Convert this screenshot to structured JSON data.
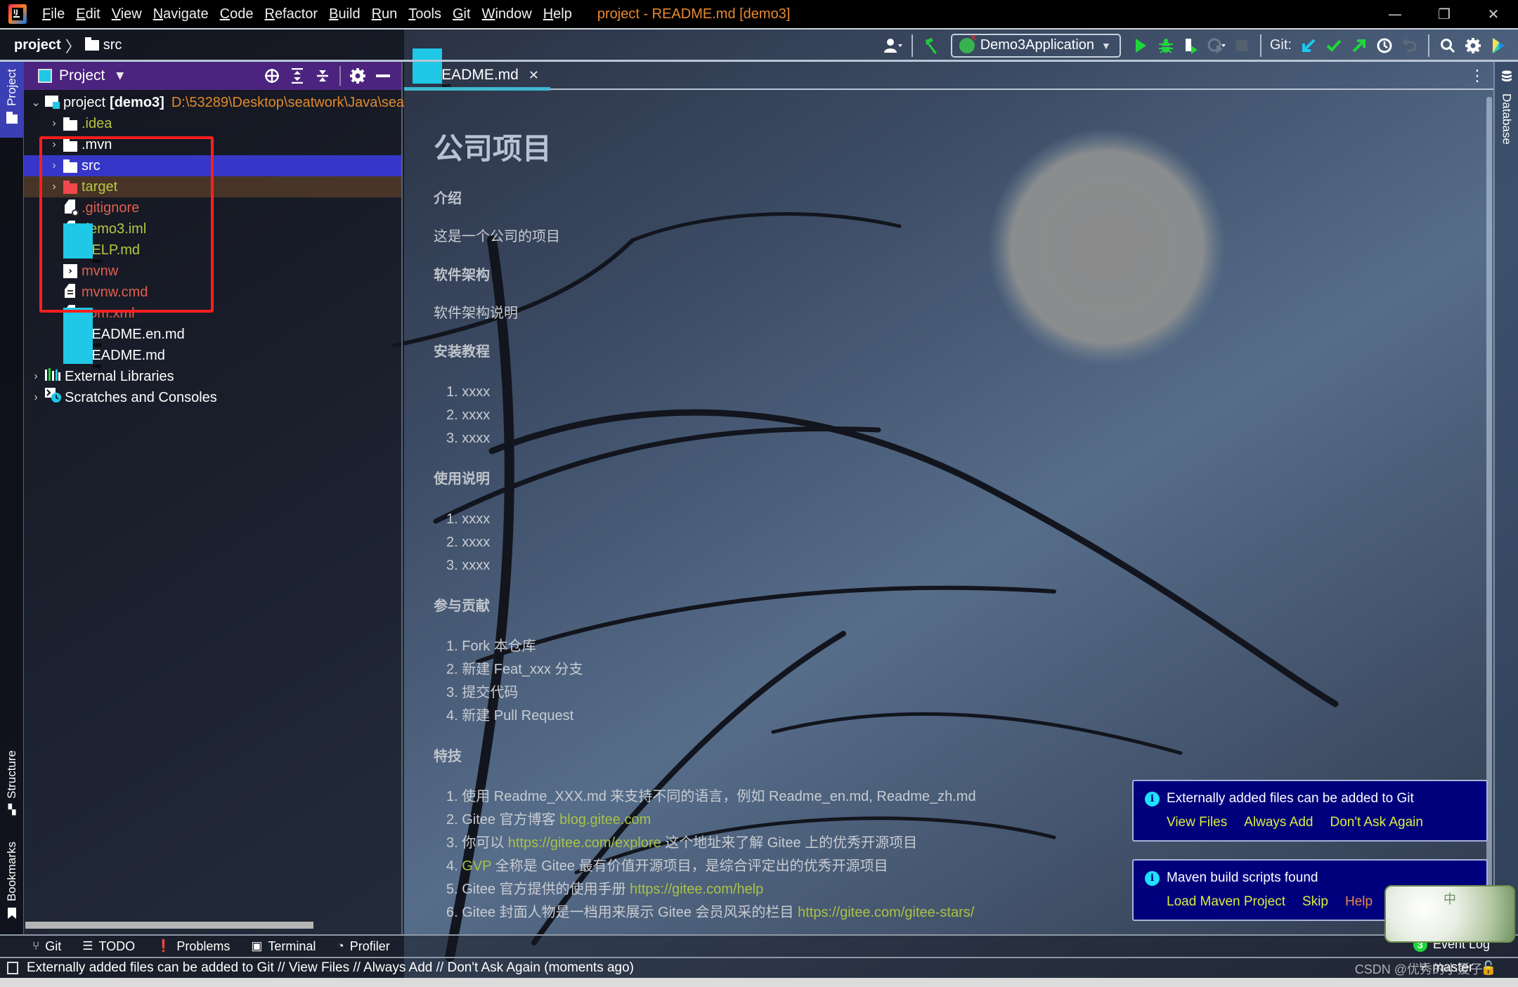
{
  "titlebar": {
    "menu": [
      "File",
      "Edit",
      "View",
      "Navigate",
      "Code",
      "Refactor",
      "Build",
      "Run",
      "Tools",
      "Git",
      "Window",
      "Help"
    ],
    "window_title": "project - README.md [demo3]",
    "controls": {
      "minimize": "—",
      "restore": "❐",
      "close": "✕"
    }
  },
  "navbar": {
    "breadcrumb": {
      "root": "project",
      "separator": "〉",
      "leaf": "src"
    },
    "run_config": "Demo3Application",
    "git_label": "Git:"
  },
  "left_stripe": {
    "project": "Project",
    "structure": "Structure",
    "bookmarks": "Bookmarks"
  },
  "right_stripe": {
    "database": "Database"
  },
  "project_panel": {
    "title": "Project",
    "root": {
      "name": "project",
      "module": "[demo3]",
      "path": "D:\\53289\\Desktop\\seatwork\\Java\\sea"
    },
    "items": [
      {
        "name": ".idea",
        "type": "folder",
        "color": "olive",
        "expandable": true
      },
      {
        "name": ".mvn",
        "type": "folder",
        "color": "white",
        "expandable": true
      },
      {
        "name": "src",
        "type": "folder",
        "color": "white",
        "expandable": true,
        "selected": true
      },
      {
        "name": "target",
        "type": "folder-excluded",
        "color": "olive",
        "expandable": true
      },
      {
        "name": ".gitignore",
        "type": "file",
        "color": "red"
      },
      {
        "name": "demo3.iml",
        "type": "file",
        "color": "olive"
      },
      {
        "name": "HELP.md",
        "type": "md",
        "color": "olive"
      },
      {
        "name": "mvnw",
        "type": "shell",
        "color": "red"
      },
      {
        "name": "mvnw.cmd",
        "type": "text",
        "color": "red"
      },
      {
        "name": "pom.xml",
        "type": "xml",
        "color": "red"
      },
      {
        "name": "README.en.md",
        "type": "md",
        "color": "white"
      },
      {
        "name": "README.md",
        "type": "md",
        "color": "white"
      }
    ],
    "extra": [
      {
        "name": "External Libraries"
      },
      {
        "name": "Scratches and Consoles"
      }
    ]
  },
  "editor": {
    "tab": {
      "label": "README.md",
      "badge": "MD"
    },
    "markdown": {
      "title": "公司项目",
      "sections": [
        {
          "heading": "介绍",
          "text": "这是一个公司的项目"
        },
        {
          "heading": "软件架构",
          "text": "软件架构说明"
        },
        {
          "heading": "安装教程",
          "list": [
            "1. xxxx",
            "2. xxxx",
            "3. xxxx"
          ]
        },
        {
          "heading": "使用说明",
          "list": [
            "1. xxxx",
            "2. xxxx",
            "3. xxxx"
          ]
        },
        {
          "heading": "参与贡献",
          "list": [
            "1. Fork 本仓库",
            "2. 新建 Feat_xxx 分支",
            "3. 提交代码",
            "4. 新建 Pull Request"
          ]
        },
        {
          "heading": "特技"
        }
      ],
      "features": [
        {
          "pre": "1. 使用 Readme_XXX.md 来支持不同的语言，例如 Readme_en.md, Readme_zh.md",
          "link": "",
          "post": ""
        },
        {
          "pre": "2. Gitee 官方博客 ",
          "link": "blog.gitee.com",
          "post": ""
        },
        {
          "pre": "3. 你可以 ",
          "link": "https://gitee.com/explore",
          "post": " 这个地址来了解 Gitee 上的优秀开源项目"
        },
        {
          "pre": "4. ",
          "link": "GVP",
          "post": " 全称是 Gitee 最有价值开源项目，是综合评定出的优秀开源项目"
        },
        {
          "pre": "5. Gitee 官方提供的使用手册 ",
          "link": "https://gitee.com/help",
          "post": ""
        },
        {
          "pre": "6. Gitee 封面人物是一档用来展示 Gitee 会员风采的栏目 ",
          "link": "https://gitee.com/gitee-stars/",
          "post": ""
        }
      ]
    }
  },
  "notifications": [
    {
      "title": "Externally added files can be added to Git",
      "actions": [
        "View Files",
        "Always Add",
        "Don't Ask Again"
      ]
    },
    {
      "title": "Maven build scripts found",
      "actions": [
        "Load Maven Project",
        "Skip",
        "Help"
      ]
    }
  ],
  "sticker": {
    "char": "中"
  },
  "bottom_toolbar": {
    "buttons": [
      "Git",
      "TODO",
      "Problems",
      "Terminal",
      "Profiler"
    ],
    "event_log": {
      "label": "Event Log",
      "count": "3"
    }
  },
  "status_bar": {
    "message": "Externally added files can be added to Git // View Files // Always Add // Don't Ask Again (moments ago)",
    "branch": "master",
    "watermark": "CSDN @优秀的小爱子"
  },
  "colors": {
    "title_accent": "#e8892e",
    "selection": "#3c3ce6",
    "panel_header": "#54268c",
    "notification_bg": "#00007d",
    "link": "#a9c246",
    "action": "#d9ee3c",
    "highlight_box": "#ff1f1f",
    "event_badge": "#1fd63a"
  }
}
